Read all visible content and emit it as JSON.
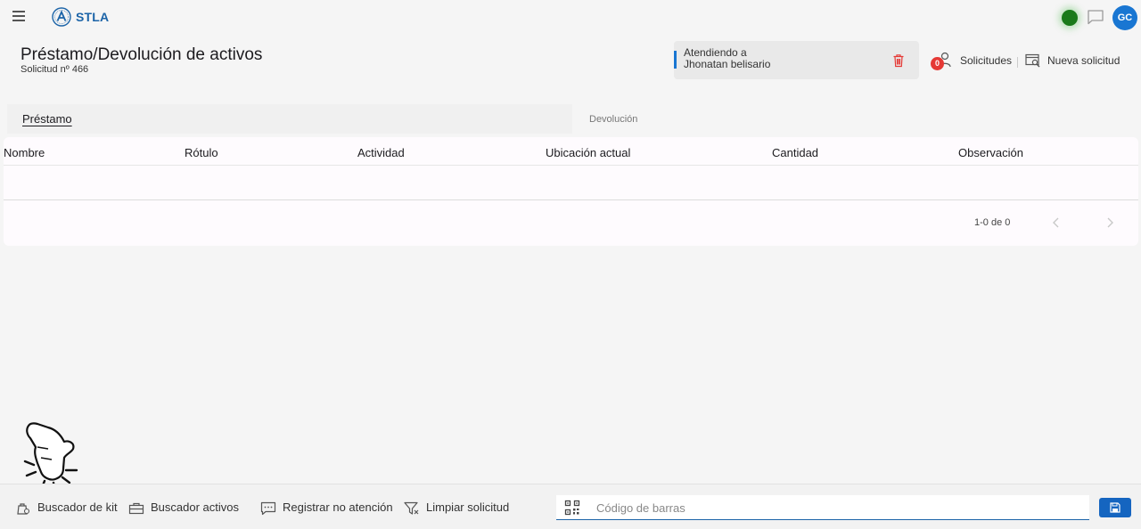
{
  "app": {
    "brand": "STLA"
  },
  "header": {
    "title": "Préstamo/Devolución de activos",
    "subtitle": "Solicitud nº 466",
    "user_initials": "GC"
  },
  "attending": {
    "label": "Atendiendo a",
    "name": "Jhonatan belisario"
  },
  "actions": {
    "solicitudes_label": "Solicitudes",
    "solicitudes_count": "0",
    "nueva_solicitud_label": "Nueva solicitud"
  },
  "tabs": [
    {
      "label": "Préstamo",
      "active": true
    },
    {
      "label": "Devolución",
      "active": false
    }
  ],
  "table": {
    "columns": [
      "Nombre",
      "Rótulo",
      "Actividad",
      "Ubicación actual",
      "Cantidad",
      "Observación"
    ],
    "rows": [],
    "pagination": "1-0 de 0"
  },
  "bottom_bar": {
    "kit_search": "Buscador de kit",
    "asset_search": "Buscador activos",
    "register_no_attention": "Registrar no atención",
    "clear_request": "Limpiar solicitud",
    "barcode_placeholder": "Código de barras"
  },
  "colors": {
    "accent": "#1976d2",
    "status_online": "#1a7a1a",
    "badge": "#e53935",
    "delete": "#e53935"
  },
  "icons": [
    "menu-icon",
    "logo-icon",
    "chat-icon",
    "trash-icon",
    "solicitudes-icon",
    "new-request-icon",
    "chevron-left-icon",
    "chevron-right-icon",
    "pointer-hand-icon",
    "kit-icon",
    "toolbox-icon",
    "comment-icon",
    "filter-clear-icon",
    "qr-code-icon",
    "save-icon"
  ]
}
